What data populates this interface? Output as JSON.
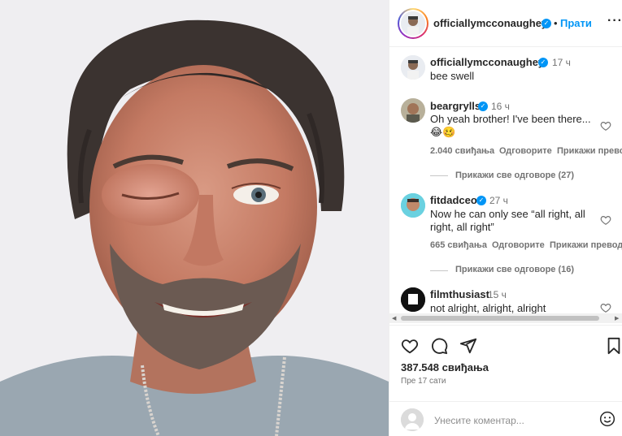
{
  "post": {
    "author": "officiallymcconaughey",
    "follow_separator": "•",
    "follow_label": "Прати",
    "more_label": "···",
    "photo_description": "photo"
  },
  "caption": {
    "username": "officiallymcconaughey",
    "time": "17 ч",
    "text": "bee swell"
  },
  "comments": [
    {
      "username": "beargrylls",
      "time": "16 ч",
      "text": "Oh yeah brother! I've been there...",
      "emoji": "😂🥴",
      "likes": "2.040 свиђања",
      "reply": "Одговорите",
      "translate": "Прикажи превод",
      "view_replies": "Прикажи све одговоре (27)"
    },
    {
      "username": "fitdadceo",
      "time": "27 ч",
      "text_line1": "Now he can only see “all right, all",
      "text_line2": "right, all right”",
      "likes": "665 свиђања",
      "reply": "Одговорите",
      "translate": "Прикажи превод",
      "view_replies": "Прикажи све одговоре (16)"
    },
    {
      "username": "filmthusiast",
      "time": "15 ч",
      "text": "not alright, alright, alright"
    }
  ],
  "stats": {
    "likes": "387.548 свиђања",
    "posted_ago": "Пре 17 сати"
  },
  "add_comment": {
    "placeholder": "Унесите коментар..."
  },
  "icons": {
    "like": "heart-icon",
    "comment": "comment-icon",
    "share": "send-icon",
    "save": "bookmark-icon",
    "emoji": "smiley-icon"
  },
  "colors": {
    "accent": "#0095f6",
    "muted": "#737373",
    "text": "#262626"
  }
}
